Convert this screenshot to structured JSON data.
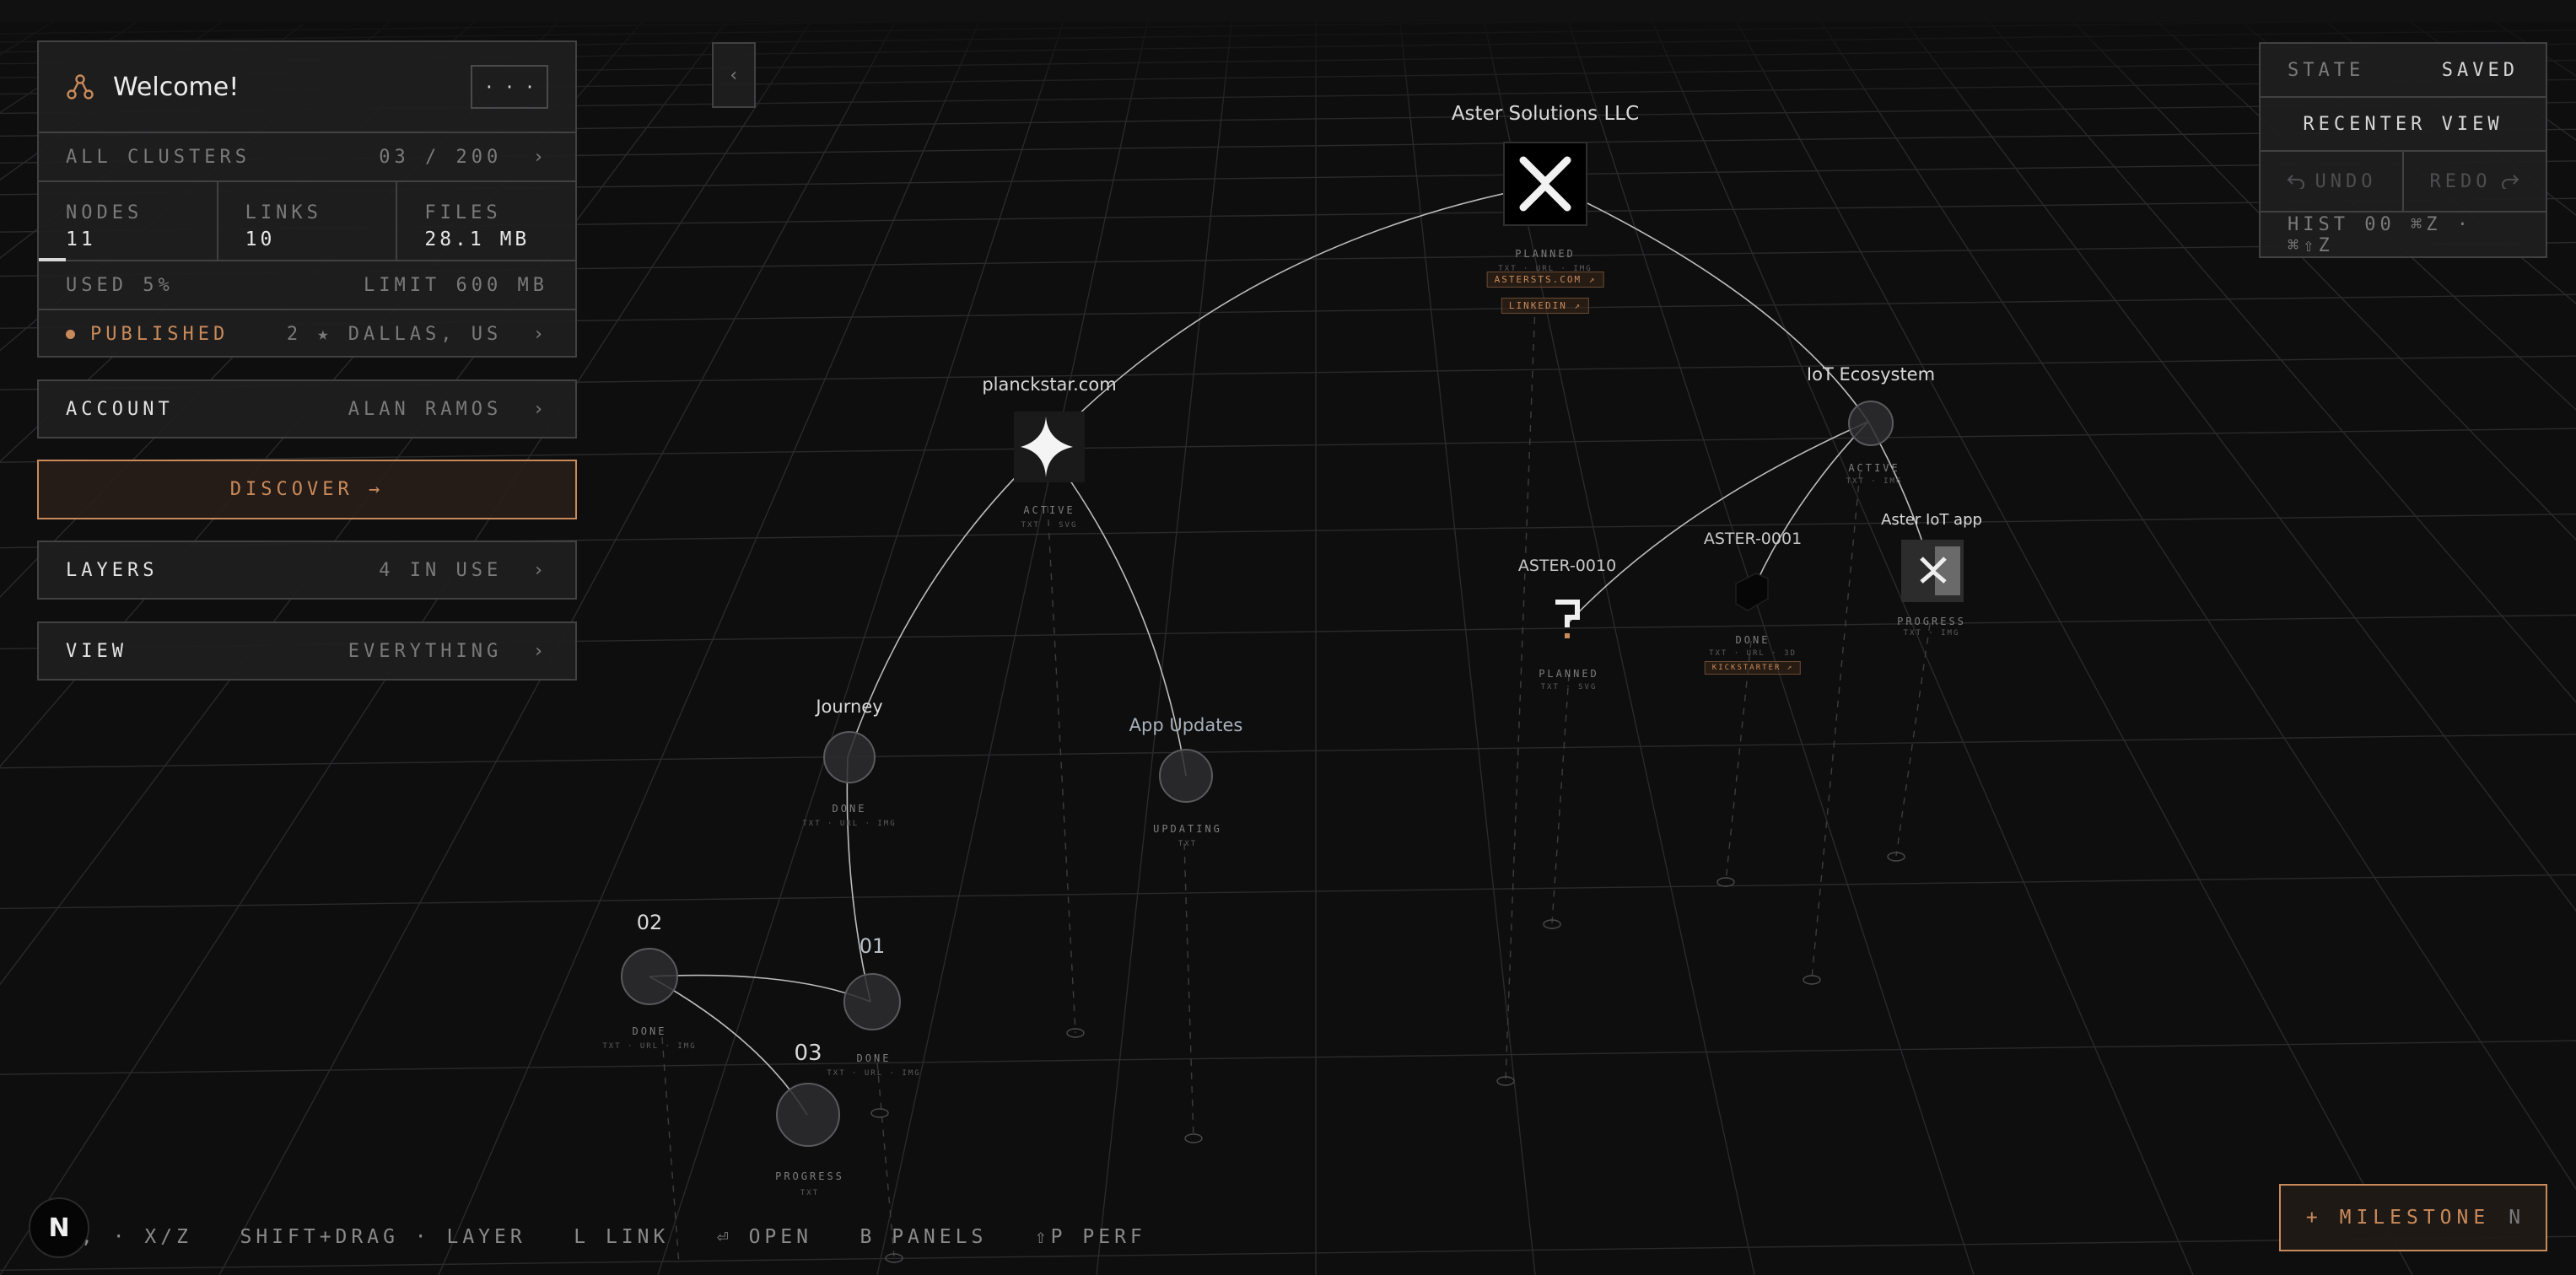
{
  "panel": {
    "title": "Welcome!",
    "more_label": "· · ·",
    "clusters_label": "ALL CLUSTERS",
    "clusters_value": "03 / 200",
    "stats": [
      {
        "label": "NODES",
        "value": "11"
      },
      {
        "label": "LINKS",
        "value": "10"
      },
      {
        "label": "FILES",
        "value": "28.1 MB"
      }
    ],
    "used_label": "USED 5%",
    "used_fraction": 0.05,
    "limit_label": "LIMIT 600 MB",
    "status_label": "PUBLISHED",
    "status_meta": "2 ★ DALLAS, US",
    "account_label": "ACCOUNT",
    "account_value": "ALAN RAMOS",
    "discover_label": "DISCOVER →",
    "layers_label": "LAYERS",
    "layers_value": "4 IN USE",
    "view_label": "VIEW",
    "view_value": "EVERYTHING",
    "chevron": "›",
    "collapse_label": "‹"
  },
  "state_panel": {
    "state_label": "STATE",
    "state_value": "SAVED",
    "recenter_label": "RECENTER VIEW",
    "undo_label": "UNDO",
    "redo_label": "REDO",
    "history_label": "HIST 00 ⌘Z · ⌘⇧Z"
  },
  "nodes": {
    "aster": {
      "label": "Aster Solutions LLC",
      "status": "PLANNED",
      "meta": "TXT · URL · IMG",
      "tags": [
        "ASTERSTS.COM ↗",
        "LINKEDIN ↗"
      ]
    },
    "planck": {
      "label": "planckstar.com",
      "status": "ACTIVE",
      "meta": "TXT · SVG"
    },
    "iot": {
      "label": "IoT Ecosystem",
      "status": "ACTIVE",
      "meta": "TXT · IMG"
    },
    "aster0010": {
      "label": "ASTER-0010",
      "status": "PLANNED",
      "meta": "TXT · SVG"
    },
    "aster0001": {
      "label": "ASTER-0001",
      "status": "DONE",
      "meta": "TXT · URL · 3D",
      "tags": [
        "KICKSTARTER ↗"
      ]
    },
    "asteriot": {
      "label": "Aster IoT app",
      "status": "PROGRESS",
      "meta": "TXT · IMG"
    },
    "journey": {
      "label": "Journey",
      "status": "DONE",
      "meta": "TXT · URL · IMG"
    },
    "appupdates": {
      "label": "App Updates",
      "status": "UPDATING",
      "meta": "TXT"
    },
    "n02": {
      "label": "02",
      "status": "DONE",
      "meta": "TXT · URL · IMG"
    },
    "n01": {
      "label": "01",
      "status": "DONE",
      "meta": "TXT · URL · IMG"
    },
    "n03": {
      "label": "03",
      "status": "PROGRESS",
      "meta": "TXT"
    }
  },
  "footer": {
    "logo_letter": "N",
    "hints": ", · X/Z   SHIFT+DRAG · LAYER   L LINK   ⏎ OPEN   B PANELS   ⇧P PERF",
    "milestone_label": "+ MILESTONE",
    "milestone_key": "N"
  },
  "colors": {
    "background": "#0e0e0f",
    "accent": "#c98a5a",
    "panel_border": "#414143"
  }
}
